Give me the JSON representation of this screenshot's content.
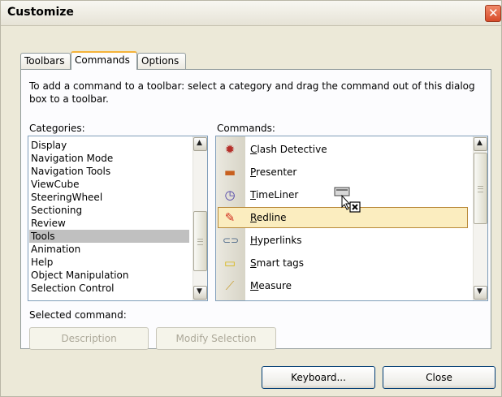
{
  "window": {
    "title": "Customize",
    "close_glyph": "✕"
  },
  "tabs": [
    {
      "label": "Toolbars"
    },
    {
      "label": "Commands"
    },
    {
      "label": "Options"
    }
  ],
  "intro_text": "To add a command to a toolbar: select a category and drag the command out of this dialog box to a toolbar.",
  "categories": {
    "label": "Categories:",
    "items": [
      "Display",
      "Navigation Mode",
      "Navigation Tools",
      "ViewCube",
      "SteeringWheel",
      "Sectioning",
      "Review",
      "Tools",
      "Animation",
      "Help",
      "Object Manipulation",
      "Selection Control"
    ],
    "selected": "Tools"
  },
  "commands": {
    "label": "Commands:",
    "items": [
      {
        "underline": "C",
        "rest": "lash Detective",
        "icon": "clash-detective-icon"
      },
      {
        "underline": "P",
        "rest": "resenter",
        "icon": "presenter-icon"
      },
      {
        "underline": "T",
        "rest": "imeLiner",
        "icon": "timeliner-icon"
      },
      {
        "underline": "R",
        "rest": "edline",
        "icon": "redline-icon"
      },
      {
        "underline": "H",
        "rest": "yperlinks",
        "icon": "hyperlinks-icon"
      },
      {
        "underline": "S",
        "rest": "mart tags",
        "icon": "smart-tags-icon"
      },
      {
        "underline": "M",
        "rest": "easure",
        "icon": "measure-icon"
      }
    ],
    "highlighted": "Redline"
  },
  "selected_command": {
    "label": "Selected command:",
    "description_button": "Description",
    "modify_button": "Modify Selection"
  },
  "footer": {
    "keyboard_button": "Keyboard...",
    "close_button": "Close"
  },
  "colors": {
    "dialog_bg": "#ece9d8",
    "selection_gray": "#c0c0c0",
    "highlight_bg": "#fbedbf",
    "highlight_border": "#b98a3a",
    "close_red": "#d74b2a"
  }
}
